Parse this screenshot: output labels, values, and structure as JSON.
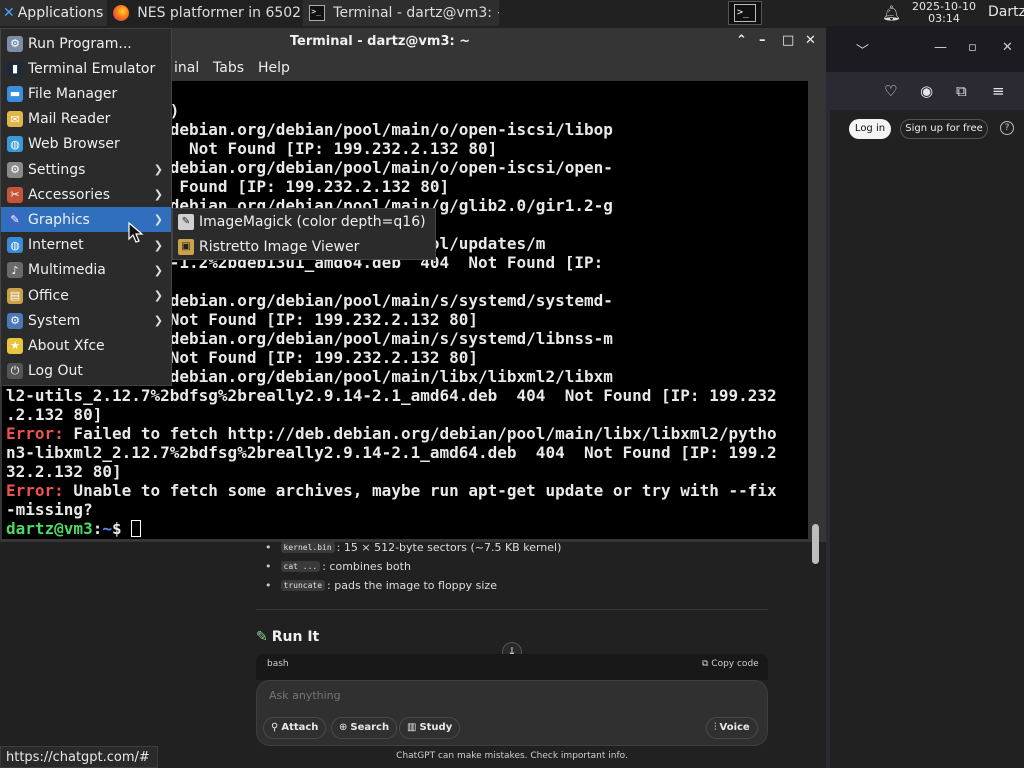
{
  "panel": {
    "applications_label": "Applications",
    "tasks": [
      {
        "label": "NES platformer in 6502 ...",
        "icon": "firefox-icon"
      },
      {
        "label": "Terminal - dartz@vm3: ~",
        "icon": "terminal-icon"
      }
    ],
    "clock_date": "2025-10-10",
    "clock_time": "03:14",
    "user": "Dartz"
  },
  "terminal": {
    "title": "Terminal - dartz@vm3: ~",
    "menu": [
      "Terminal",
      "Tabs",
      "Help"
    ],
    "menu_visible": [
      "inal",
      "Tabs",
      "Help"
    ],
    "lines": [
      {
        "t": "  18s (6,713 kB/s)"
      },
      {
        "t": "fetch http://deb.debian.org/debian/pool/main/o/open-iscsi/libop"
      },
      {
        "t": "-1_amd64.deb  404  Not Found [IP: 199.232.2.132 80]"
      },
      {
        "t": "fetch http://deb.debian.org/debian/pool/main/o/open-iscsi/open-"
      },
      {
        "t": "d64.deb  404  Not Found [IP: 199.232.2.132 80]"
      },
      {
        "t": "fetch http://deb.debian.org/debian/pool/main/g/glib2.0/gir1.2-g"
      },
      {
        "t": "                   [IP: 199.232.2.132 80]"
      },
      {
        "t": "                   an.org/debian-security/pool/updates/m"
      },
      {
        "t": "libxslt1.1_1.1.35-1.2%2bdeb13u1_amd64.deb  404  Not Found [IP:"
      },
      {
        "t": ""
      },
      {
        "t": "fetch http://deb.debian.org/debian/pool/main/s/systemd/systemd-"
      },
      {
        "t": "_amd64.deb  404  Not Found [IP: 199.232.2.132 80]"
      },
      {
        "t": "fetch http://deb.debian.org/debian/pool/main/s/systemd/libnss-m"
      },
      {
        "t": "_amd64.deb  404  Not Found [IP: 199.232.2.132 80]"
      },
      {
        "t": "fetch http://deb.debian.org/debian/pool/main/libx/libxml2/libxm"
      },
      {
        "t": "l2-utils_2.12.7%2bdfsg%2breally2.9.14-2.1_amd64.deb  404  Not Found [IP: 199.232"
      },
      {
        "t": ".2.132 80]"
      },
      {
        "err": "Error:",
        "t": " Failed to fetch http://deb.debian.org/debian/pool/main/libx/libxml2/pytho"
      },
      {
        "t": "n3-libxml2_2.12.7%2bdfsg%2breally2.9.14-2.1_amd64.deb  404  Not Found [IP: 199.2"
      },
      {
        "t": "32.2.132 80]"
      },
      {
        "err": "Error:",
        "t": " Unable to fetch some archives, maybe run apt-get update or try with --fix"
      },
      {
        "t": "-missing?"
      }
    ],
    "prompt_user": "dartz@vm3",
    "prompt_path": "~",
    "prompt_sign": "$"
  },
  "appmenu": {
    "items": [
      {
        "label": "Run Program...",
        "icon": "run-program-icon",
        "color": "#7a8ea8",
        "sub": false
      },
      {
        "label": "Terminal Emulator",
        "icon": "terminal-icon",
        "color": "#1e2a3a",
        "sub": false
      },
      {
        "label": "File Manager",
        "icon": "folder-icon",
        "color": "#3a8de0",
        "sub": false
      },
      {
        "label": "Mail Reader",
        "icon": "mail-icon",
        "color": "#e0b84a",
        "sub": false
      },
      {
        "label": "Web Browser",
        "icon": "globe-icon",
        "color": "#3a9ad9",
        "sub": false
      },
      {
        "label": "Settings",
        "icon": "settings-icon",
        "color": "#8a8a8a",
        "sub": true
      },
      {
        "label": "Accessories",
        "icon": "accessories-icon",
        "color": "#c4553a",
        "sub": true
      },
      {
        "label": "Graphics",
        "icon": "graphics-icon",
        "color": "#3a68c4",
        "sub": true
      },
      {
        "label": "Internet",
        "icon": "internet-icon",
        "color": "#3a8ad9",
        "sub": true
      },
      {
        "label": "Multimedia",
        "icon": "multimedia-icon",
        "color": "#6a6a6a",
        "sub": true
      },
      {
        "label": "Office",
        "icon": "office-icon",
        "color": "#c9a24a",
        "sub": true
      },
      {
        "label": "System",
        "icon": "system-icon",
        "color": "#4a7ab5",
        "sub": true
      },
      {
        "label": "About Xfce",
        "icon": "star-icon",
        "color": "#e8c53a",
        "sub": false
      },
      {
        "label": "Log Out",
        "icon": "logout-icon",
        "color": "#555555",
        "sub": false
      }
    ],
    "active_index": 7,
    "submenu": [
      {
        "label": "ImageMagick (color depth=q16)",
        "icon": "imagemagick-icon"
      },
      {
        "label": "Ristretto Image Viewer",
        "icon": "image-viewer-icon"
      }
    ]
  },
  "browser": {
    "login": "Log in",
    "signup": "Sign up for free",
    "bullets": [
      {
        "code": "kernel.bin",
        "text": ": 15 × 512-byte sectors (~7.5 KB kernel)"
      },
      {
        "code": "cat ...",
        "text": ": combines both"
      },
      {
        "code": "truncate",
        "text": ": pads the image to floppy size"
      }
    ],
    "section_title": "Run It",
    "code_lang": "bash",
    "copy_code": "Copy code",
    "composer_placeholder": "Ask anything",
    "buttons": {
      "attach": "Attach",
      "search": "Search",
      "study": "Study",
      "voice": "Voice"
    },
    "disclaimer": "ChatGPT can make mistakes. Check important info.",
    "status_url": "https://chatgpt.com/#"
  }
}
